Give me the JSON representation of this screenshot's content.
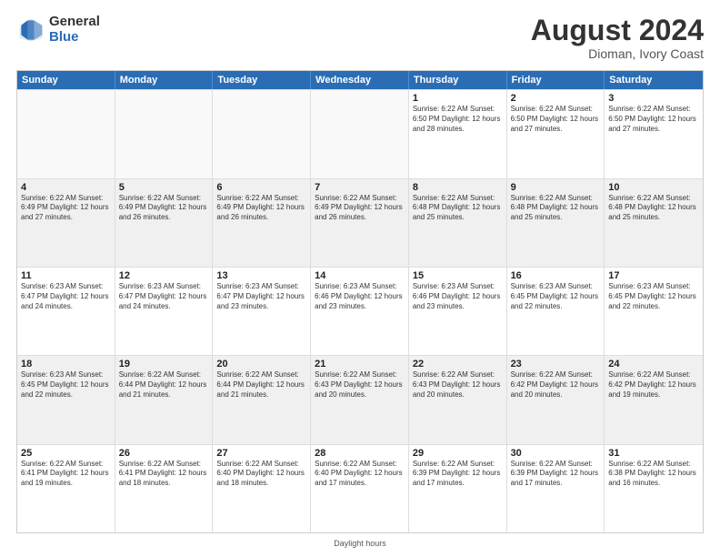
{
  "header": {
    "logo_general": "General",
    "logo_blue": "Blue",
    "main_title": "August 2024",
    "sub_title": "Dioman, Ivory Coast"
  },
  "calendar": {
    "days": [
      "Sunday",
      "Monday",
      "Tuesday",
      "Wednesday",
      "Thursday",
      "Friday",
      "Saturday"
    ],
    "rows": [
      [
        {
          "day": "",
          "text": "",
          "empty": true
        },
        {
          "day": "",
          "text": "",
          "empty": true
        },
        {
          "day": "",
          "text": "",
          "empty": true
        },
        {
          "day": "",
          "text": "",
          "empty": true
        },
        {
          "day": "1",
          "text": "Sunrise: 6:22 AM\nSunset: 6:50 PM\nDaylight: 12 hours and 28 minutes."
        },
        {
          "day": "2",
          "text": "Sunrise: 6:22 AM\nSunset: 6:50 PM\nDaylight: 12 hours and 27 minutes."
        },
        {
          "day": "3",
          "text": "Sunrise: 6:22 AM\nSunset: 6:50 PM\nDaylight: 12 hours and 27 minutes."
        }
      ],
      [
        {
          "day": "4",
          "text": "Sunrise: 6:22 AM\nSunset: 6:49 PM\nDaylight: 12 hours and 27 minutes."
        },
        {
          "day": "5",
          "text": "Sunrise: 6:22 AM\nSunset: 6:49 PM\nDaylight: 12 hours and 26 minutes."
        },
        {
          "day": "6",
          "text": "Sunrise: 6:22 AM\nSunset: 6:49 PM\nDaylight: 12 hours and 26 minutes."
        },
        {
          "day": "7",
          "text": "Sunrise: 6:22 AM\nSunset: 6:49 PM\nDaylight: 12 hours and 26 minutes."
        },
        {
          "day": "8",
          "text": "Sunrise: 6:22 AM\nSunset: 6:48 PM\nDaylight: 12 hours and 25 minutes."
        },
        {
          "day": "9",
          "text": "Sunrise: 6:22 AM\nSunset: 6:48 PM\nDaylight: 12 hours and 25 minutes."
        },
        {
          "day": "10",
          "text": "Sunrise: 6:22 AM\nSunset: 6:48 PM\nDaylight: 12 hours and 25 minutes."
        }
      ],
      [
        {
          "day": "11",
          "text": "Sunrise: 6:23 AM\nSunset: 6:47 PM\nDaylight: 12 hours and 24 minutes."
        },
        {
          "day": "12",
          "text": "Sunrise: 6:23 AM\nSunset: 6:47 PM\nDaylight: 12 hours and 24 minutes."
        },
        {
          "day": "13",
          "text": "Sunrise: 6:23 AM\nSunset: 6:47 PM\nDaylight: 12 hours and 23 minutes."
        },
        {
          "day": "14",
          "text": "Sunrise: 6:23 AM\nSunset: 6:46 PM\nDaylight: 12 hours and 23 minutes."
        },
        {
          "day": "15",
          "text": "Sunrise: 6:23 AM\nSunset: 6:46 PM\nDaylight: 12 hours and 23 minutes."
        },
        {
          "day": "16",
          "text": "Sunrise: 6:23 AM\nSunset: 6:45 PM\nDaylight: 12 hours and 22 minutes."
        },
        {
          "day": "17",
          "text": "Sunrise: 6:23 AM\nSunset: 6:45 PM\nDaylight: 12 hours and 22 minutes."
        }
      ],
      [
        {
          "day": "18",
          "text": "Sunrise: 6:23 AM\nSunset: 6:45 PM\nDaylight: 12 hours and 22 minutes."
        },
        {
          "day": "19",
          "text": "Sunrise: 6:22 AM\nSunset: 6:44 PM\nDaylight: 12 hours and 21 minutes."
        },
        {
          "day": "20",
          "text": "Sunrise: 6:22 AM\nSunset: 6:44 PM\nDaylight: 12 hours and 21 minutes."
        },
        {
          "day": "21",
          "text": "Sunrise: 6:22 AM\nSunset: 6:43 PM\nDaylight: 12 hours and 20 minutes."
        },
        {
          "day": "22",
          "text": "Sunrise: 6:22 AM\nSunset: 6:43 PM\nDaylight: 12 hours and 20 minutes."
        },
        {
          "day": "23",
          "text": "Sunrise: 6:22 AM\nSunset: 6:42 PM\nDaylight: 12 hours and 20 minutes."
        },
        {
          "day": "24",
          "text": "Sunrise: 6:22 AM\nSunset: 6:42 PM\nDaylight: 12 hours and 19 minutes."
        }
      ],
      [
        {
          "day": "25",
          "text": "Sunrise: 6:22 AM\nSunset: 6:41 PM\nDaylight: 12 hours and 19 minutes."
        },
        {
          "day": "26",
          "text": "Sunrise: 6:22 AM\nSunset: 6:41 PM\nDaylight: 12 hours and 18 minutes."
        },
        {
          "day": "27",
          "text": "Sunrise: 6:22 AM\nSunset: 6:40 PM\nDaylight: 12 hours and 18 minutes."
        },
        {
          "day": "28",
          "text": "Sunrise: 6:22 AM\nSunset: 6:40 PM\nDaylight: 12 hours and 17 minutes."
        },
        {
          "day": "29",
          "text": "Sunrise: 6:22 AM\nSunset: 6:39 PM\nDaylight: 12 hours and 17 minutes."
        },
        {
          "day": "30",
          "text": "Sunrise: 6:22 AM\nSunset: 6:39 PM\nDaylight: 12 hours and 17 minutes."
        },
        {
          "day": "31",
          "text": "Sunrise: 6:22 AM\nSunset: 6:38 PM\nDaylight: 12 hours and 16 minutes."
        }
      ]
    ]
  },
  "footer": {
    "text": "Daylight hours"
  }
}
